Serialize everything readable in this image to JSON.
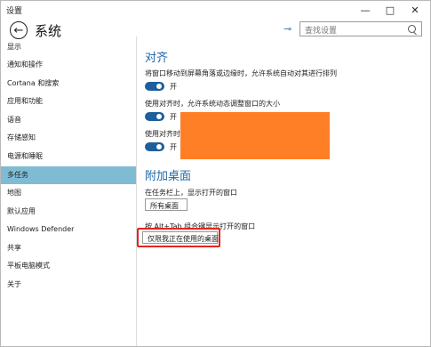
{
  "window": {
    "title": "设置",
    "controls": {
      "minimize": "—",
      "maximize": "□",
      "close": "✕"
    }
  },
  "header": {
    "title": "系统",
    "back_glyph": "←",
    "pin_glyph": "⊸",
    "search": {
      "placeholder": "查找设置"
    }
  },
  "sidebar": {
    "items": [
      {
        "label": "显示"
      },
      {
        "label": "通知和操作"
      },
      {
        "label": "Cortana 和搜索"
      },
      {
        "label": "应用和功能"
      },
      {
        "label": "语音"
      },
      {
        "label": "存储感知"
      },
      {
        "label": "电源和睡眠"
      },
      {
        "label": "多任务",
        "active": true
      },
      {
        "label": "地图"
      },
      {
        "label": "默认应用"
      },
      {
        "label": "Windows Defender"
      },
      {
        "label": "共享"
      },
      {
        "label": "平板电脑模式"
      },
      {
        "label": "关于"
      }
    ]
  },
  "snap": {
    "title": "对齐",
    "settings": [
      {
        "desc": "将窗口移动到屏幕角落或边缘时，允许系统自动对其进行排列",
        "state": "开"
      },
      {
        "desc": "使用对齐时，允许系统动态调整窗口的大小",
        "state": "开"
      },
      {
        "desc": "使用对齐时，",
        "state": "开"
      }
    ]
  },
  "desktops": {
    "title": "附加桌面",
    "taskbar": {
      "desc": "在任务栏上，显示打开的窗口",
      "value": "所有桌面"
    },
    "alttab": {
      "desc": "按 Alt+Tab 组合键显示打开的窗口",
      "value": "仅限我正在使用的桌面"
    }
  },
  "colors": {
    "accent": "#1c5f9b",
    "selected_nav": "#7fbcd4",
    "redaction": "#ff7f27",
    "highlight": "#e3261f"
  }
}
